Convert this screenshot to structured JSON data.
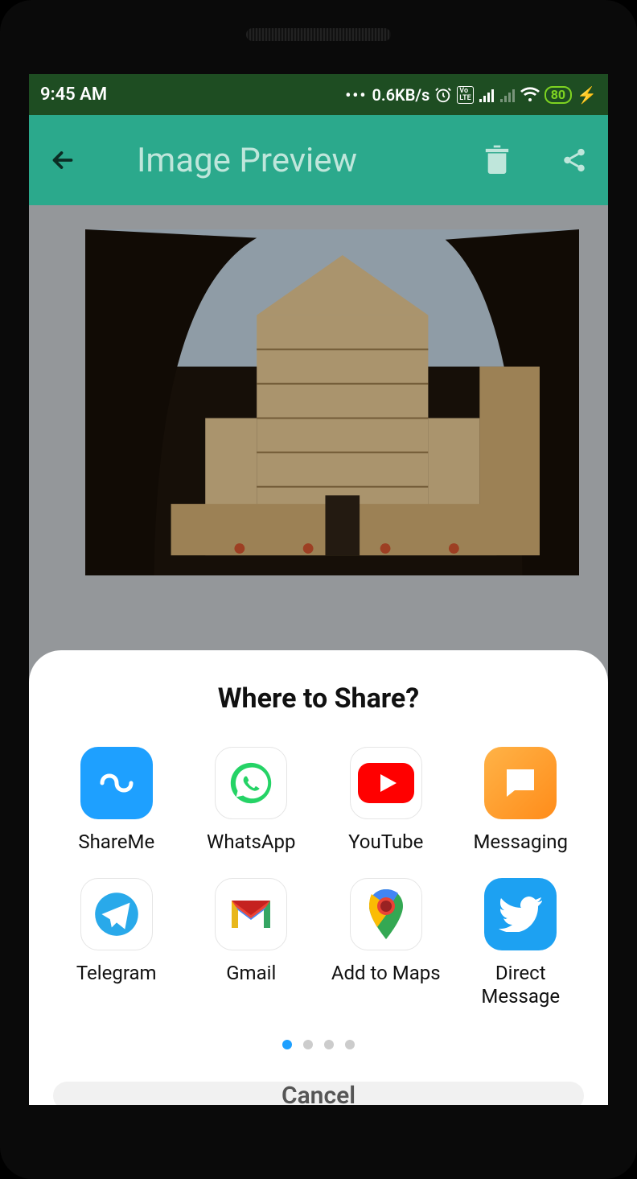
{
  "status": {
    "time": "9:45 AM",
    "net_speed": "0.6KB/s",
    "battery": "80"
  },
  "appbar": {
    "title": "Image Preview"
  },
  "share_sheet": {
    "title": "Where to Share?",
    "cancel": "Cancel",
    "items": [
      {
        "label": "ShareMe"
      },
      {
        "label": "WhatsApp"
      },
      {
        "label": "YouTube"
      },
      {
        "label": "Messaging"
      },
      {
        "label": "Telegram"
      },
      {
        "label": "Gmail"
      },
      {
        "label": "Add to Maps"
      },
      {
        "label": "Direct Message"
      }
    ],
    "page_count": 4,
    "active_page": 0
  }
}
